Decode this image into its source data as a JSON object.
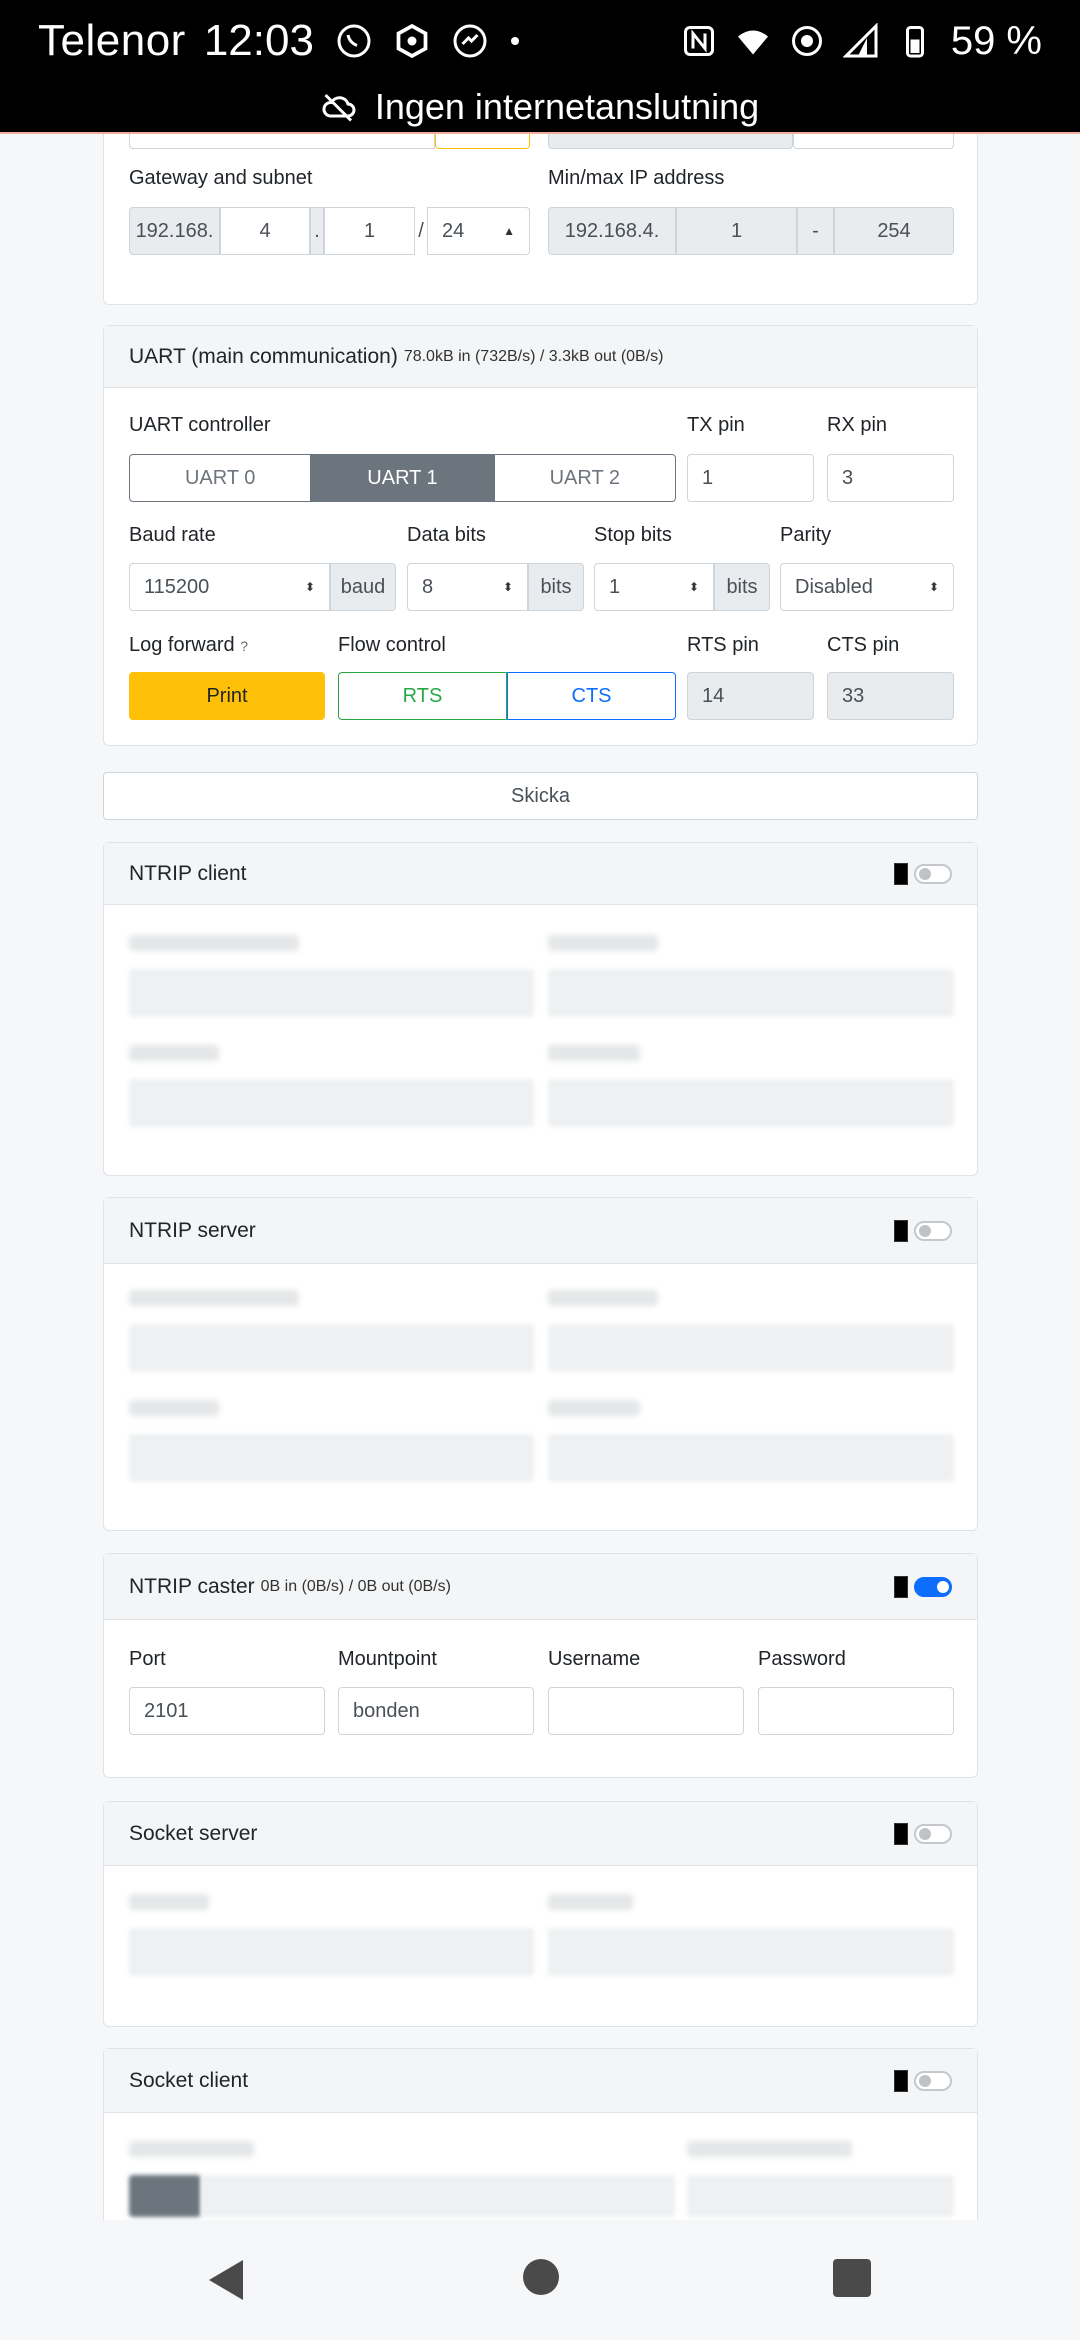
{
  "status_bar": {
    "carrier": "Telenor",
    "time": "12:03",
    "battery": "59 %",
    "network_notice": "Ingen internetanslutning"
  },
  "network": {
    "gateway_label": "Gateway and subnet",
    "gateway_prefix": "192.168.",
    "gateway_octet3": "4",
    "gateway_dot": ".",
    "gateway_octet4": "1",
    "slash": "/",
    "subnet": "24",
    "minmax_label": "Min/max IP address",
    "ip_prefix": "192.168.4.",
    "ip_min": "1",
    "dash": "-",
    "ip_max": "254"
  },
  "uart": {
    "title": "UART (main communication)",
    "stats": "78.0kB in (732B/s) / 3.3kB out (0B/s)",
    "controller_label": "UART controller",
    "controllers": [
      "UART 0",
      "UART 1",
      "UART 2"
    ],
    "selected_controller": "UART 1",
    "tx_label": "TX pin",
    "tx_value": "1",
    "rx_label": "RX pin",
    "rx_value": "3",
    "baud_label": "Baud rate",
    "baud_value": "115200",
    "baud_unit": "baud",
    "databits_label": "Data bits",
    "databits_value": "8",
    "bits_unit": "bits",
    "stopbits_label": "Stop bits",
    "stopbits_value": "1",
    "parity_label": "Parity",
    "parity_value": "Disabled",
    "logforward_label": "Log forward",
    "logforward_help": "?",
    "print_label": "Print",
    "flow_label": "Flow control",
    "rts_btn": "RTS",
    "cts_btn": "CTS",
    "rts_pin_label": "RTS pin",
    "rts_pin_value": "14",
    "cts_pin_label": "CTS pin",
    "cts_pin_value": "33"
  },
  "submit_label": "Skicka",
  "ntrip_client": {
    "title": "NTRIP client",
    "enabled": false
  },
  "ntrip_server": {
    "title": "NTRIP server",
    "enabled": false
  },
  "ntrip_caster": {
    "title": "NTRIP caster",
    "stats": "0B in (0B/s) / 0B out (0B/s)",
    "enabled": true,
    "port_label": "Port",
    "port_value": "2101",
    "mountpoint_label": "Mountpoint",
    "mountpoint_value": "bonden",
    "username_label": "Username",
    "username_value": "",
    "password_label": "Password",
    "password_value": ""
  },
  "socket_server": {
    "title": "Socket server",
    "enabled": false
  },
  "socket_client": {
    "title": "Socket client",
    "enabled": false
  },
  "colors": {
    "accent_yellow": "#ffc107",
    "toggle_on": "#0d6efd",
    "segment_active": "#6c757d",
    "rts_green": "#28a745",
    "cts_blue": "#0d6efd"
  }
}
